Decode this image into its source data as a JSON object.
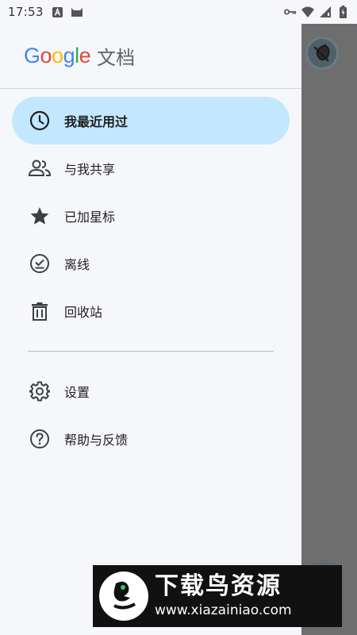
{
  "status_bar": {
    "time": "17:53",
    "left_icons": [
      "a-notification-icon",
      "cat-notification-icon"
    ],
    "right_icons": [
      "vpn-key-icon",
      "wifi-icon",
      "signal-icon",
      "battery-icon"
    ]
  },
  "drawer": {
    "brand": {
      "google_letters": [
        {
          "ch": "G",
          "color": "#4285F4"
        },
        {
          "ch": "o",
          "color": "#EA4335"
        },
        {
          "ch": "o",
          "color": "#FBBC05"
        },
        {
          "ch": "g",
          "color": "#4285F4"
        },
        {
          "ch": "l",
          "color": "#34A853"
        },
        {
          "ch": "e",
          "color": "#EA4335"
        }
      ],
      "product": "文档"
    },
    "primary_items": [
      {
        "label": "我最近用过",
        "icon": "clock-icon",
        "active": true
      },
      {
        "label": "与我共享",
        "icon": "people-icon",
        "active": false
      },
      {
        "label": "已加星标",
        "icon": "star-icon",
        "active": false
      },
      {
        "label": "离线",
        "icon": "offline-icon",
        "active": false
      },
      {
        "label": "回收站",
        "icon": "trash-icon",
        "active": false
      }
    ],
    "secondary_items": [
      {
        "label": "设置",
        "icon": "gear-icon"
      },
      {
        "label": "帮助与反馈",
        "icon": "help-icon"
      }
    ]
  },
  "colors": {
    "active_item_bg": "#c2e7ff",
    "drawer_bg": "#f6f7fb",
    "scrim": "#6e6e6e",
    "icon": "#3c4043"
  },
  "watermark": {
    "cn": "下载鸟资源",
    "url": "www.xiazainiao.com"
  }
}
